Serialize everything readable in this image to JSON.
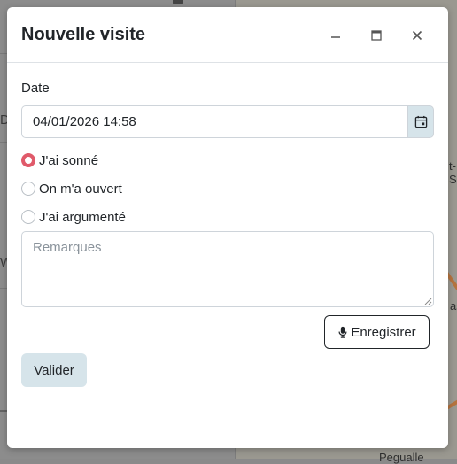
{
  "background": {
    "sidebar_fragments": [
      "Do",
      "W",
      "—"
    ],
    "map_labels": [
      "t-S",
      "as",
      "Pegualle"
    ]
  },
  "modal": {
    "title": "Nouvelle visite",
    "minimize_icon": "minimize-icon",
    "maximize_icon": "maximize-icon",
    "close_icon": "close-icon"
  },
  "form": {
    "date_label": "Date",
    "date_value": "04/01/2026 14:58",
    "calendar_icon": "calendar-icon",
    "radios": [
      {
        "label": "J'ai sonné",
        "checked": true
      },
      {
        "label": "On m'a ouvert",
        "checked": false
      },
      {
        "label": "J'ai argumenté",
        "checked": false
      }
    ],
    "remarks_placeholder": "Remarques",
    "remarks_value": "",
    "record_label": "Enregistrer",
    "record_icon": "microphone-icon",
    "submit_label": "Valider"
  },
  "colors": {
    "accent_radio": "#e05a6a",
    "button_tint": "#d6e4ea"
  }
}
